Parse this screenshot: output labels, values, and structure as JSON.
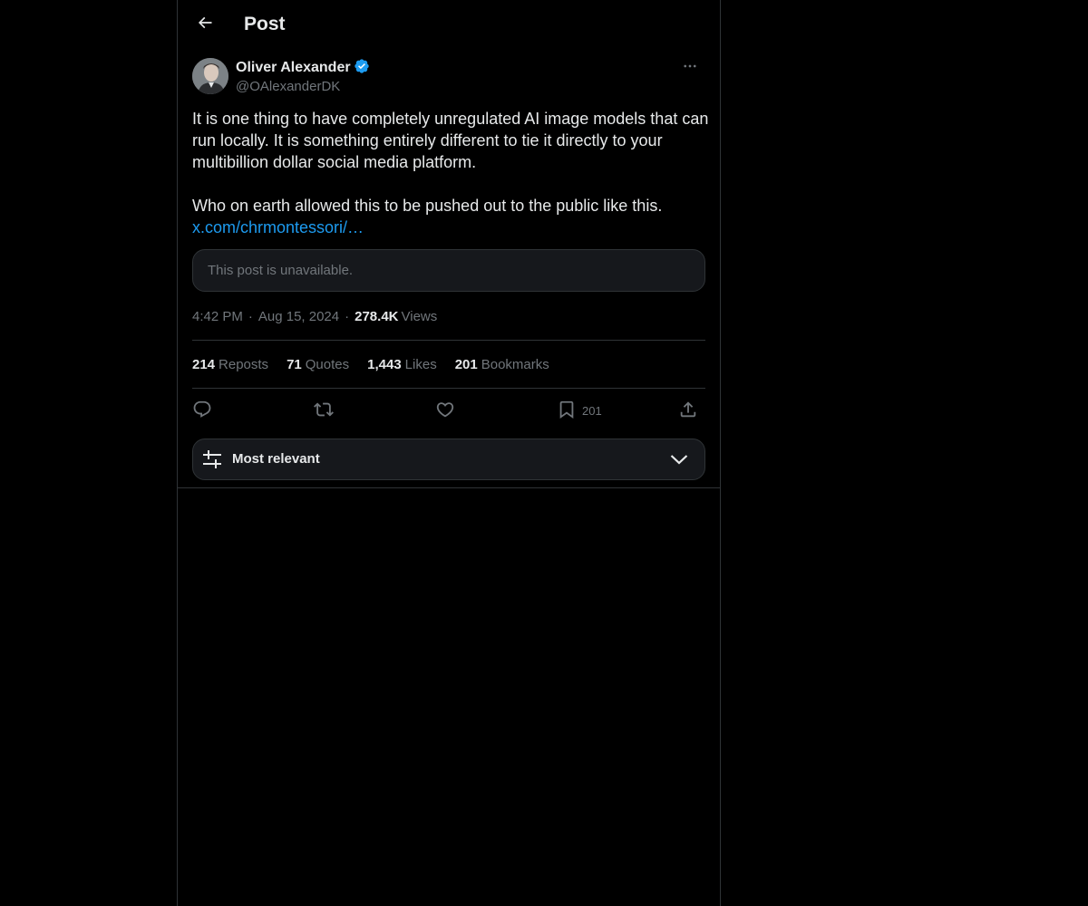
{
  "header": {
    "title": "Post",
    "back_icon": "arrow-left-icon"
  },
  "author": {
    "name": "Oliver Alexander",
    "handle": "@OAlexanderDK",
    "verified": true,
    "verified_color": "#1d9bf0"
  },
  "post": {
    "paragraph_1": "It is one thing to have completely unregulated AI image models that can run locally. It is something entirely different to tie it directly to your multibillion dollar social media platform.",
    "paragraph_2": "Who on earth allowed this to be pushed out to the public like this.",
    "link_text": "x.com/chrmontessori/…",
    "quote_unavailable": "This post is unavailable."
  },
  "meta": {
    "time": "4:42 PM",
    "date": "Aug 15, 2024",
    "views_count": "278.4K",
    "views_label": "Views"
  },
  "stats": {
    "reposts_count": "214",
    "reposts_label": "Reposts",
    "quotes_count": "71",
    "quotes_label": "Quotes",
    "likes_count": "1,443",
    "likes_label": "Likes",
    "bookmarks_count": "201",
    "bookmarks_label": "Bookmarks"
  },
  "actions": {
    "bookmark_count": "201"
  },
  "sort": {
    "label": "Most relevant"
  },
  "colors": {
    "background": "#000000",
    "text": "#e7e9ea",
    "muted": "#71767b",
    "link": "#1d9bf0",
    "border": "#2f3336"
  }
}
